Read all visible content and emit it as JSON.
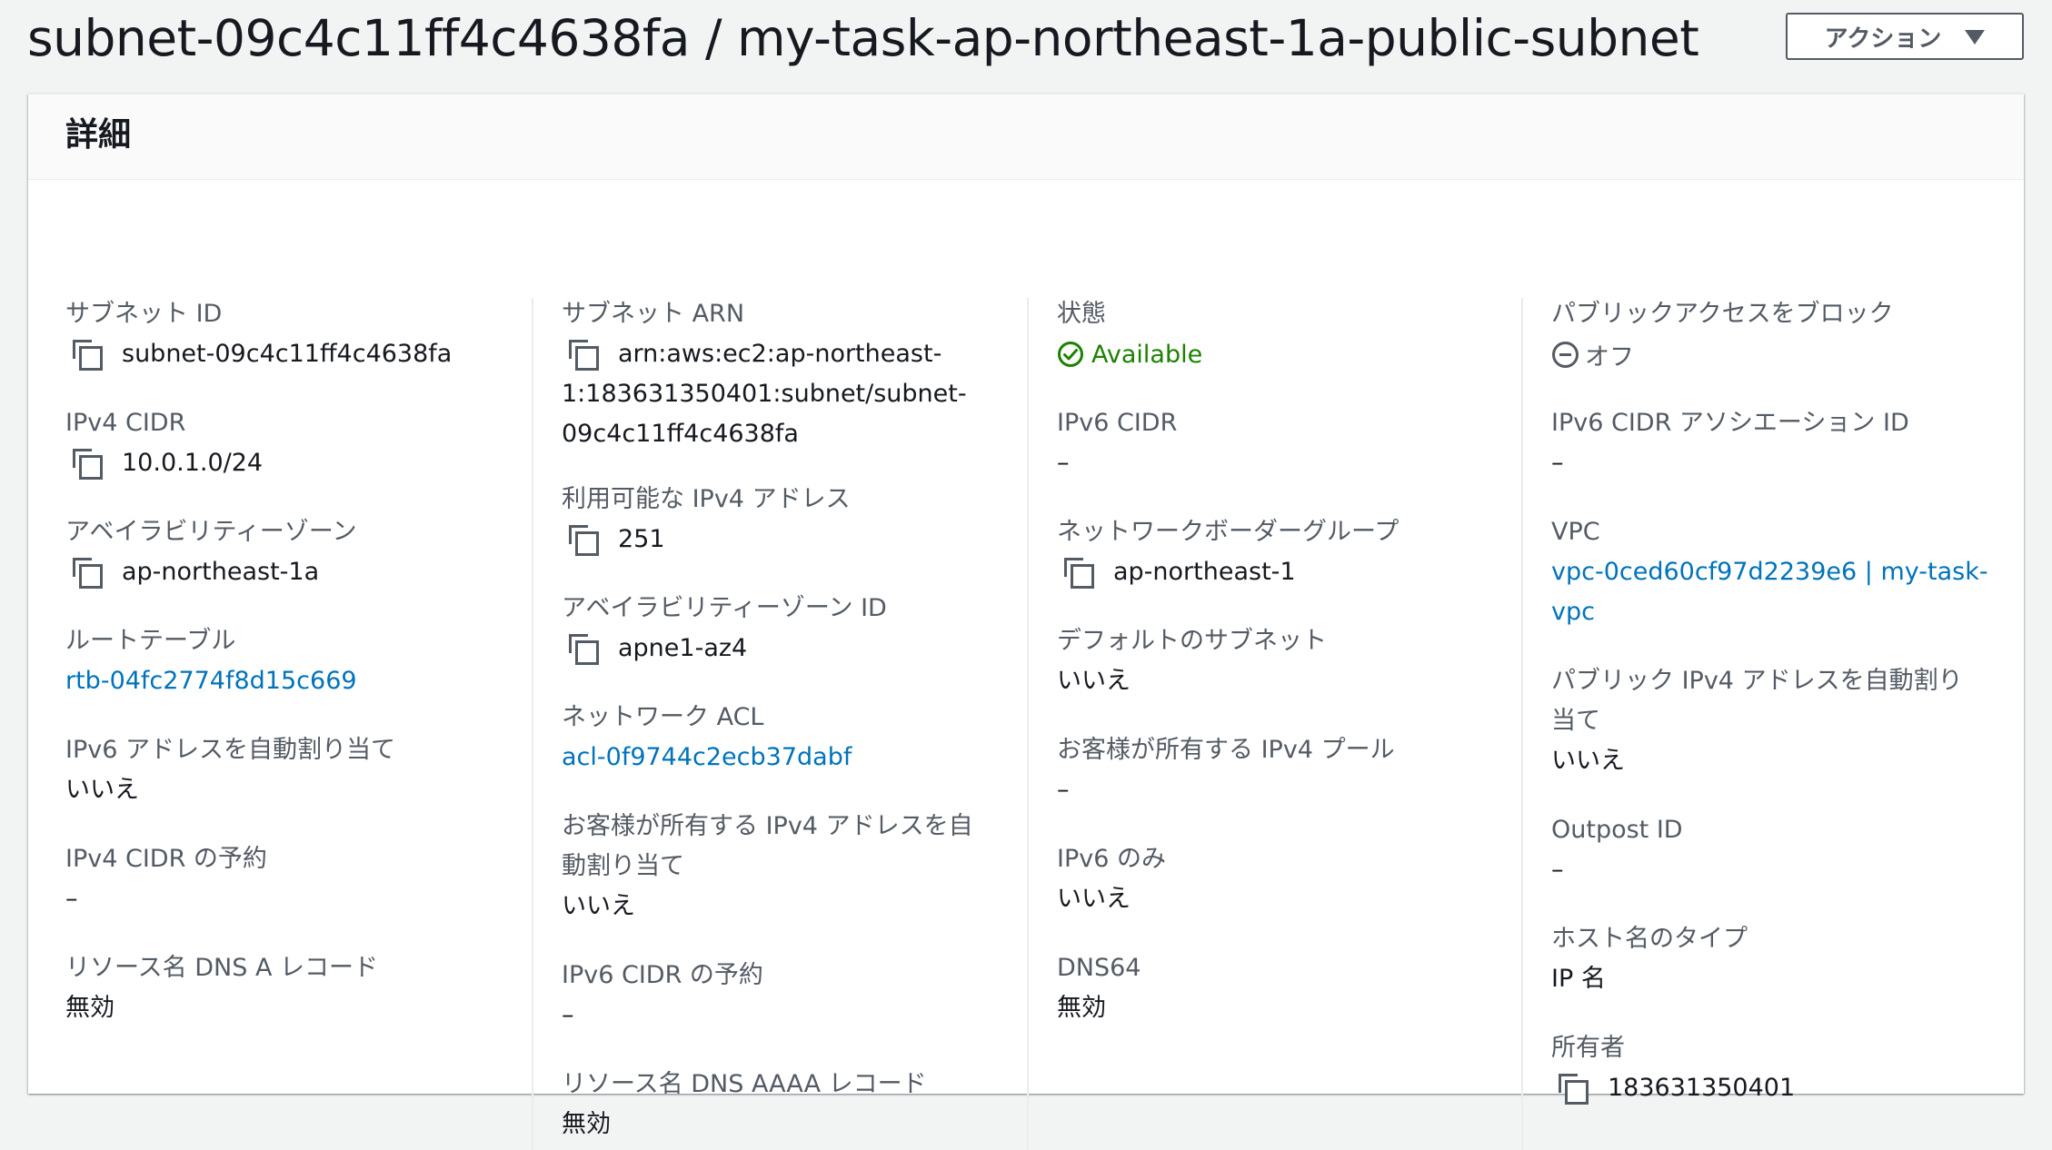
{
  "header": {
    "title": "subnet-09c4c11ff4c4638fa / my-task-ap-northeast-1a-public-subnet",
    "actions_label": "アクション"
  },
  "panel": {
    "title": "詳細"
  },
  "col1": {
    "subnet_id_label": "サブネット ID",
    "subnet_id_value": "subnet-09c4c11ff4c4638fa",
    "ipv4_cidr_label": "IPv4 CIDR",
    "ipv4_cidr_value": "10.0.1.0/24",
    "az_label": "アベイラビリティーゾーン",
    "az_value": "ap-northeast-1a",
    "route_table_label": "ルートテーブル",
    "route_table_value": "rtb-04fc2774f8d15c669",
    "ipv6_auto_label": "IPv6 アドレスを自動割り当て",
    "ipv6_auto_value": "いいえ",
    "ipv4_reservation_label": "IPv4 CIDR の予約",
    "ipv4_reservation_value": "–",
    "dns_a_label": "リソース名 DNS A レコード",
    "dns_a_value": "無効"
  },
  "col2": {
    "arn_label": "サブネット ARN",
    "arn_line1": "arn:aws:ec2:ap-northeast-",
    "arn_line2": "1:183631350401:subnet/subnet-",
    "arn_line3": "09c4c11ff4c4638fa",
    "available_ipv4_label": "利用可能な IPv4 アドレス",
    "available_ipv4_value": "251",
    "az_id_label": "アベイラビリティーゾーン ID",
    "az_id_value": "apne1-az4",
    "acl_label": "ネットワーク ACL",
    "acl_value": "acl-0f9744c2ecb37dabf",
    "customer_ipv4_auto_label_line1": "お客様が所有する IPv4 アドレスを自",
    "customer_ipv4_auto_label_line2": "動割り当て",
    "customer_ipv4_auto_value": "いいえ",
    "ipv6_reservation_label": "IPv6 CIDR の予約",
    "ipv6_reservation_value": "–",
    "dns_aaaa_label": "リソース名 DNS AAAA レコード",
    "dns_aaaa_value": "無効"
  },
  "col3": {
    "state_label": "状態",
    "state_value": "Available",
    "ipv6_cidr_label": "IPv6 CIDR",
    "ipv6_cidr_value": "–",
    "border_group_label": "ネットワークボーダーグループ",
    "border_group_value": "ap-northeast-1",
    "default_subnet_label": "デフォルトのサブネット",
    "default_subnet_value": "いいえ",
    "customer_pool_label": "お客様が所有する IPv4 プール",
    "customer_pool_value": "–",
    "ipv6_only_label": "IPv6 のみ",
    "ipv6_only_value": "いいえ",
    "dns64_label": "DNS64",
    "dns64_value": "無効"
  },
  "col4": {
    "block_public_label": "パブリックアクセスをブロック",
    "block_public_value": "オフ",
    "ipv6_assoc_label": "IPv6 CIDR アソシエーション ID",
    "ipv6_assoc_value": "–",
    "vpc_label": "VPC",
    "vpc_line1": "vpc-0ced60cf97d2239e6 | my-task-",
    "vpc_line2": "vpc",
    "public_ipv4_auto_label_line1": "パブリック IPv4 アドレスを自動割り",
    "public_ipv4_auto_label_line2": "当て",
    "public_ipv4_auto_value": "いいえ",
    "outpost_label": "Outpost ID",
    "outpost_value": "–",
    "hostname_type_label": "ホスト名のタイプ",
    "hostname_type_value": "IP 名",
    "owner_label": "所有者",
    "owner_value": "183631350401"
  },
  "colors": {
    "link": "#0073bb",
    "success": "#1d8102",
    "label": "#545b64",
    "text": "#16191f"
  },
  "icons": {
    "copy": "copy-icon",
    "status": "check-circle-icon",
    "off": "minus-circle-icon",
    "dropdown": "caret-down-icon"
  }
}
